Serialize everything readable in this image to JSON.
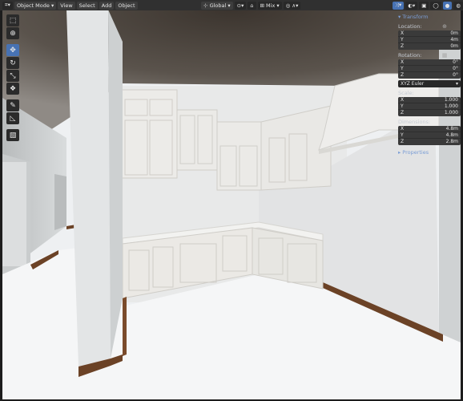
{
  "header": {
    "mode": "Object Mode",
    "menus": [
      "View",
      "Select",
      "Add",
      "Object"
    ],
    "orientation": "Global",
    "shading": "Mix"
  },
  "transform": {
    "title": "Transform",
    "location_label": "Location:",
    "location": {
      "x": "0m",
      "y": "4m",
      "z": "0m"
    },
    "rotation_label": "Rotation:",
    "rotation": {
      "x": "0°",
      "y": "0°",
      "z": "0°"
    },
    "rotation_mode": "XYZ Euler",
    "scale_label": "Scale:",
    "scale": {
      "x": "1.000",
      "y": "1.000",
      "z": "1.000"
    },
    "dimensions_label": "Dimensions:",
    "dimensions": {
      "x": "4.8m",
      "y": "4.8m",
      "z": "2.8m"
    },
    "properties": "Properties"
  },
  "axis": {
    "x": "X",
    "y": "Y",
    "z": "Z"
  },
  "colors": {
    "accent": "#4772b3",
    "panel_title": "#7b9ed6"
  }
}
